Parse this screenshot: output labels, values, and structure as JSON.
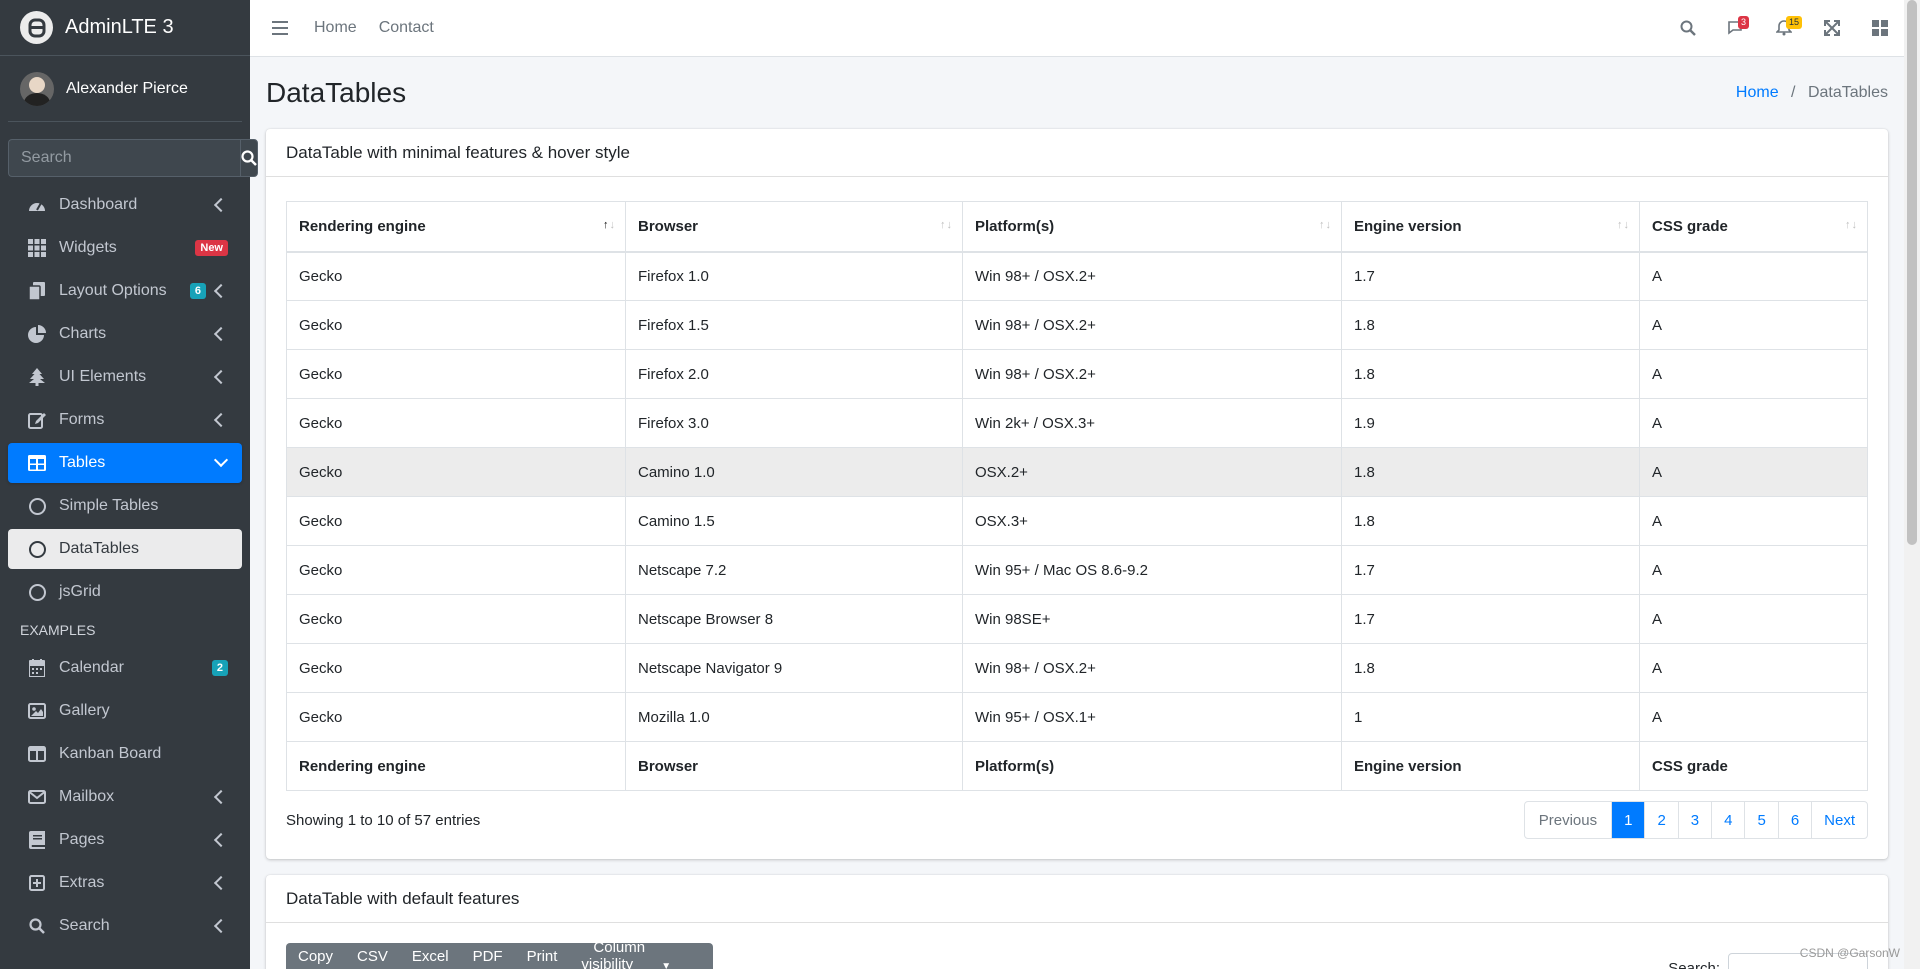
{
  "brand": {
    "name": "AdminLTE 3"
  },
  "user": {
    "name": "Alexander Pierce"
  },
  "sidebar": {
    "search_placeholder": "Search",
    "items": [
      {
        "label": "Dashboard"
      },
      {
        "label": "Widgets",
        "badge": "New"
      },
      {
        "label": "Layout Options",
        "badge": "6"
      },
      {
        "label": "Charts"
      },
      {
        "label": "UI Elements"
      },
      {
        "label": "Forms"
      },
      {
        "label": "Tables"
      },
      {
        "label": "Simple Tables"
      },
      {
        "label": "DataTables"
      },
      {
        "label": "jsGrid"
      },
      {
        "label": "Calendar",
        "badge": "2"
      },
      {
        "label": "Gallery"
      },
      {
        "label": "Kanban Board"
      },
      {
        "label": "Mailbox"
      },
      {
        "label": "Pages"
      },
      {
        "label": "Extras"
      },
      {
        "label": "Search"
      }
    ],
    "header_examples": "EXAMPLES"
  },
  "topbar": {
    "links": [
      "Home",
      "Contact"
    ],
    "messages_count": "3",
    "notifications_count": "15"
  },
  "page": {
    "title": "DataTables",
    "breadcrumb": [
      "Home",
      "/",
      "DataTables"
    ]
  },
  "card1": {
    "title": "DataTable with minimal features & hover style",
    "columns": [
      "Rendering engine",
      "Browser",
      "Platform(s)",
      "Engine version",
      "CSS grade"
    ],
    "rows": [
      [
        "Gecko",
        "Firefox 1.0",
        "Win 98+ / OSX.2+",
        "1.7",
        "A"
      ],
      [
        "Gecko",
        "Firefox 1.5",
        "Win 98+ / OSX.2+",
        "1.8",
        "A"
      ],
      [
        "Gecko",
        "Firefox 2.0",
        "Win 98+ / OSX.2+",
        "1.8",
        "A"
      ],
      [
        "Gecko",
        "Firefox 3.0",
        "Win 2k+ / OSX.3+",
        "1.9",
        "A"
      ],
      [
        "Gecko",
        "Camino 1.0",
        "OSX.2+",
        "1.8",
        "A"
      ],
      [
        "Gecko",
        "Camino 1.5",
        "OSX.3+",
        "1.8",
        "A"
      ],
      [
        "Gecko",
        "Netscape 7.2",
        "Win 95+ / Mac OS 8.6-9.2",
        "1.7",
        "A"
      ],
      [
        "Gecko",
        "Netscape Browser 8",
        "Win 98SE+",
        "1.7",
        "A"
      ],
      [
        "Gecko",
        "Netscape Navigator 9",
        "Win 98+ / OSX.2+",
        "1.8",
        "A"
      ],
      [
        "Gecko",
        "Mozilla 1.0",
        "Win 95+ / OSX.1+",
        "1",
        "A"
      ]
    ],
    "info": "Showing 1 to 10 of 57 entries",
    "pager": [
      "Previous",
      "1",
      "2",
      "3",
      "4",
      "5",
      "6",
      "Next"
    ]
  },
  "card2": {
    "title": "DataTable with default features",
    "buttons": [
      "Copy",
      "CSV",
      "Excel",
      "PDF",
      "Print",
      "Column visibility"
    ],
    "search_label": "Search:"
  },
  "watermark": "CSDN @GarsonW"
}
